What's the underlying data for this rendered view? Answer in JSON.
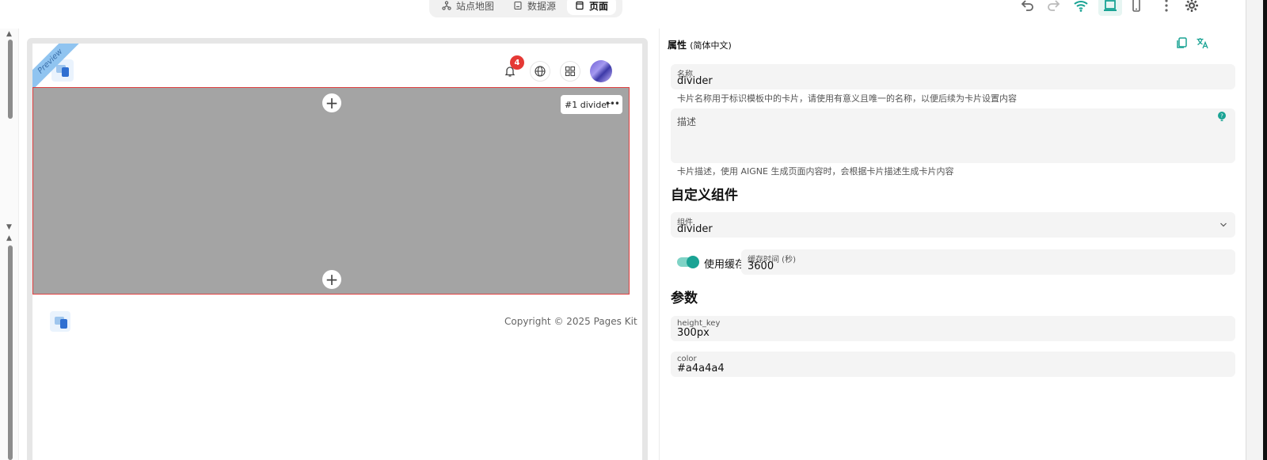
{
  "toolbar": {
    "tabs": [
      {
        "label": "站点地图",
        "icon": "sitemap-icon"
      },
      {
        "label": "数据源",
        "icon": "database-icon"
      },
      {
        "label": "页面",
        "icon": "page-icon",
        "active": true
      }
    ],
    "icons": [
      "undo-icon",
      "redo-icon",
      "wifi-icon",
      "laptop-icon",
      "mobile-icon",
      "more-vertical-icon",
      "gear-icon"
    ],
    "accent": "#1aa394"
  },
  "preview": {
    "ribbon": "Preview",
    "notification_count": "4",
    "card_tag": "#1 divider",
    "divider_color": "#a4a4a4",
    "copyright": "Copyright © 2025 Pages Kit"
  },
  "panel": {
    "title": "属性",
    "locale": "(简体中文)",
    "name_label": "名称",
    "name_value": "divider",
    "name_help": "卡片名称用于标识模板中的卡片，请使用有意义且唯一的名称，以便后续为卡片设置内容",
    "desc_label": "描述",
    "desc_help": "卡片描述，使用 AIGNE 生成页面内容时，会根据卡片描述生成卡片内容",
    "custom_section": "自定义组件",
    "component_label": "组件",
    "component_value": "divider",
    "cache_toggle_label": "使用缓存",
    "cache_time_label": "缓存时间 (秒)",
    "cache_time_value": "3600",
    "params_section": "参数",
    "params": [
      {
        "label": "height_key",
        "value": "300px"
      },
      {
        "label": "color",
        "value": "#a4a4a4"
      }
    ]
  }
}
